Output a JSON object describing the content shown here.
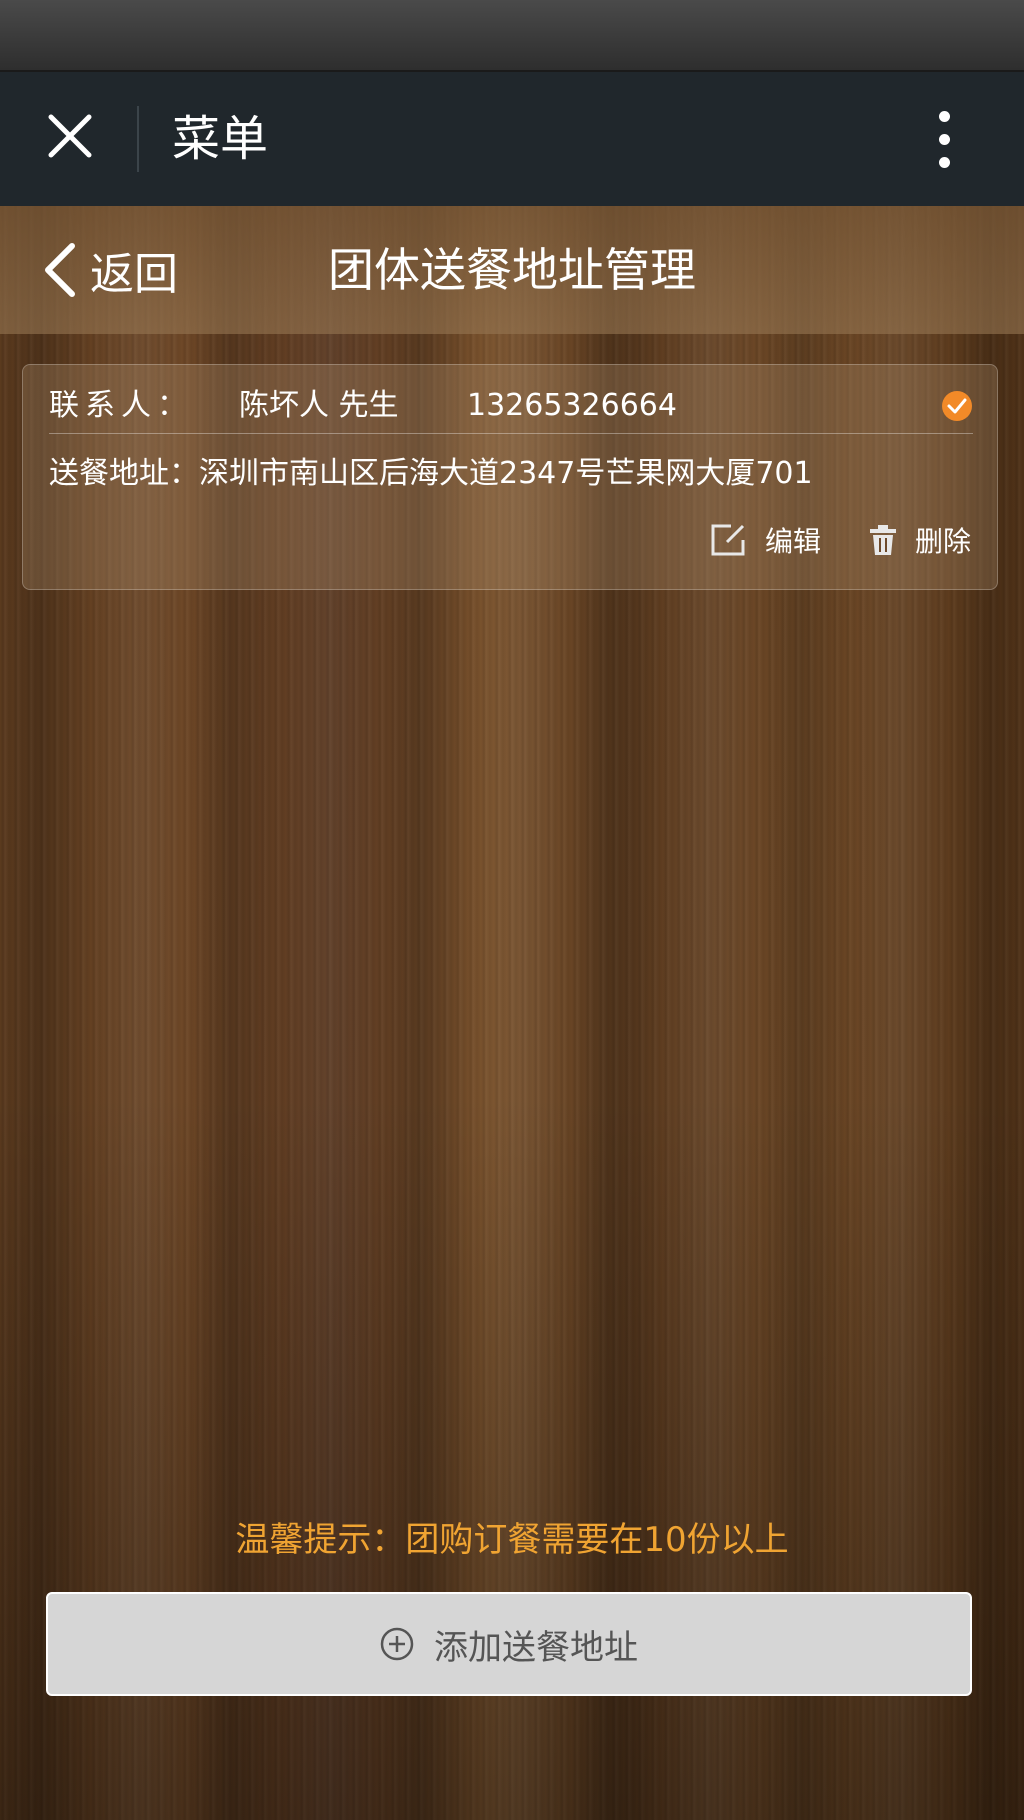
{
  "wechat_bar": {
    "title": "菜单",
    "close_icon": "close-icon",
    "more_icon": "more-vertical-icon"
  },
  "header": {
    "back_label": "返回",
    "title": "团体送餐地址管理"
  },
  "address": {
    "contact_label": "联系人：",
    "contact_name": "陈坏人 先生",
    "phone": "13265326664",
    "address_text": "送餐地址：深圳市南山区后海大道2347号芒果网大厦701",
    "selected": true,
    "edit_label": "编辑",
    "delete_label": "删除"
  },
  "tip": "温馨提示：团购订餐需要在10份以上",
  "add_button": {
    "label": "添加送餐地址",
    "icon": "plus-circle-icon"
  },
  "colors": {
    "accent": "#f0a432",
    "check": "#f28a28",
    "top_bar": "#20272c"
  }
}
